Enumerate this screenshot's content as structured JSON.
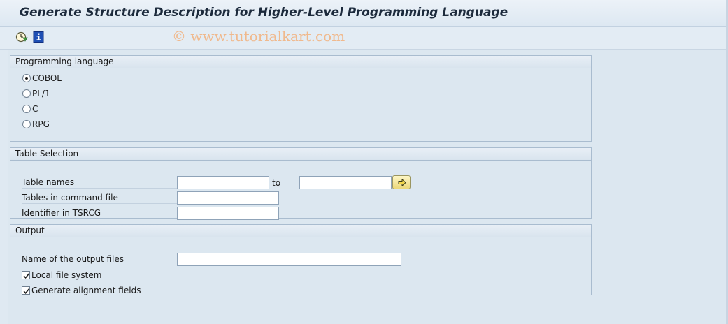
{
  "window": {
    "title": "Generate Structure Description for Higher-Level Programming Language"
  },
  "toolbar": {
    "execute_icon": "execute-clock-icon",
    "info_icon": "info-icon"
  },
  "watermark": "© www.tutorialkart.com",
  "programming_language": {
    "heading": "Programming language",
    "options": [
      {
        "label": "COBOL",
        "selected": true
      },
      {
        "label": "PL/1",
        "selected": false
      },
      {
        "label": "C",
        "selected": false
      },
      {
        "label": "RPG",
        "selected": false
      }
    ]
  },
  "table_selection": {
    "heading": "Table Selection",
    "table_names_label": "Table names",
    "table_names_from": "",
    "to_label": "to",
    "table_names_to": "",
    "multiple_selection_icon": "arrow-right-icon",
    "command_file_label": "Tables in command file",
    "command_file_value": "",
    "identifier_label": "Identifier in TSRCG",
    "identifier_value": ""
  },
  "output": {
    "heading": "Output",
    "output_files_label": "Name of the output files",
    "output_files_value": "",
    "local_file_system_label": "Local file system",
    "local_file_system_checked": true,
    "alignment_fields_label": "Generate alignment fields",
    "alignment_fields_checked": true
  },
  "colors": {
    "background": "#dce7f0",
    "title_text": "#1c2a3c",
    "watermark": "#f0b98d",
    "group_border": "#a9bccf"
  }
}
